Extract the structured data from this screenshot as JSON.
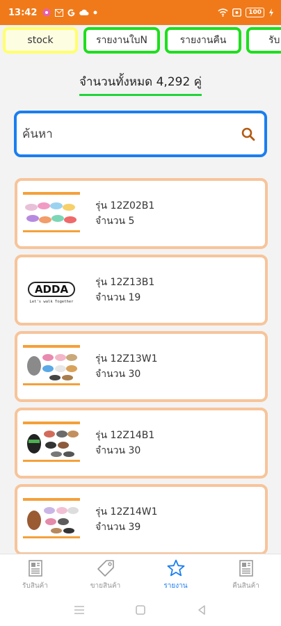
{
  "status_bar": {
    "time": "13:42",
    "battery": "100"
  },
  "tabs": [
    {
      "label": "stock"
    },
    {
      "label": "รายงานใบN"
    },
    {
      "label": "รายงานคืน"
    },
    {
      "label": "รับ"
    }
  ],
  "summary": {
    "total_text": "จำนวนทั้งหมด 4,292 คู่"
  },
  "search": {
    "placeholder": "ค้นหา",
    "value": ""
  },
  "items": [
    {
      "model": "รุ่น 12Z02B1",
      "qty": "จำนวน 5",
      "thumb": "product-sandals-colorful"
    },
    {
      "model": "รุ่น 12Z13B1",
      "qty": "จำนวน 19",
      "thumb": "adda-logo",
      "logo_text": "ADDA",
      "logo_tagline": "Let's walk Together"
    },
    {
      "model": "รุ่น 12Z13W1",
      "qty": "จำนวน 30",
      "thumb": "product-sandals-grey"
    },
    {
      "model": "รุ่น 12Z14B1",
      "qty": "จำนวน 30",
      "thumb": "product-sandals-dark"
    },
    {
      "model": "รุ่น 12Z14W1",
      "qty": "จำนวน 39",
      "thumb": "product-sandals-brown"
    }
  ],
  "bottom_nav": [
    {
      "label": "รับสินค้า",
      "icon": "newspaper-icon"
    },
    {
      "label": "ขายสินค้า",
      "icon": "tag-icon"
    },
    {
      "label": "รายงาน",
      "icon": "star-icon",
      "active": true
    },
    {
      "label": "คืนสินค้า",
      "icon": "newspaper-icon"
    }
  ],
  "colors": {
    "status_bar": "#f07a1a",
    "tab_active_border": "#ffff6e",
    "tab_border": "#1ede1e",
    "search_border": "#1a7ef0",
    "card_border": "#f7c49a",
    "nav_active": "#1a7ef0"
  }
}
